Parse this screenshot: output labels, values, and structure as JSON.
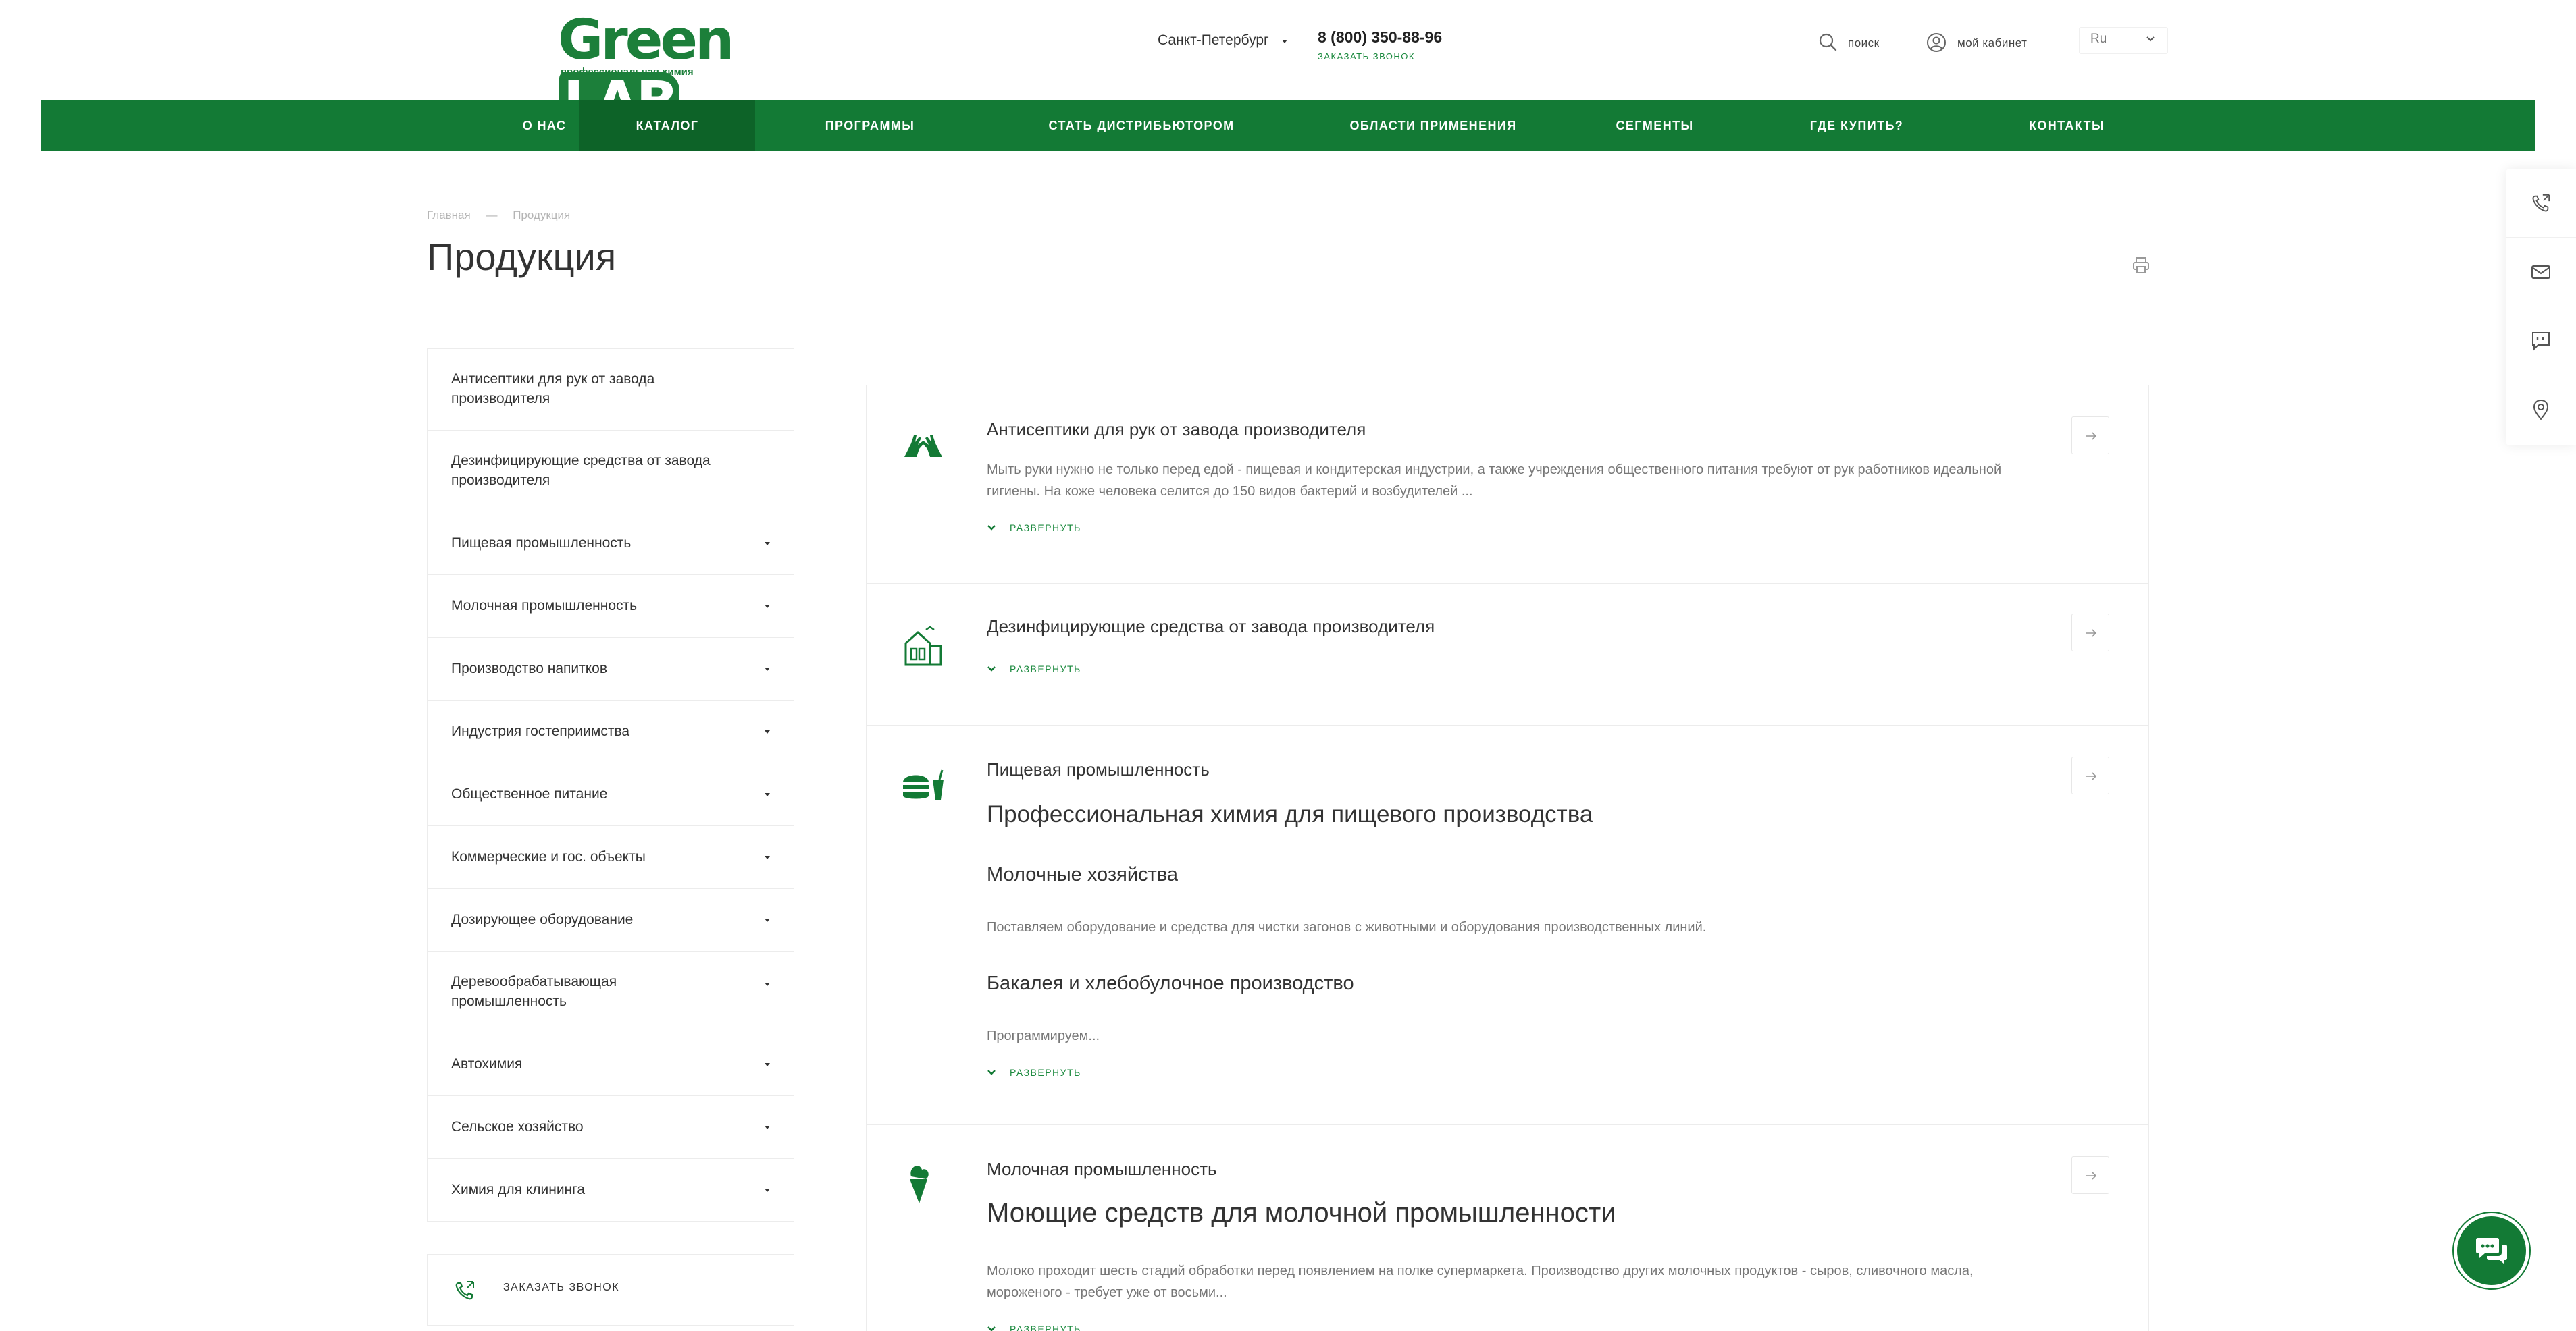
{
  "brand": {
    "logo_main": "Green",
    "logo_accent": "LAB",
    "logo_tagline": "профессиональная химия",
    "color_primary": "#137a35",
    "color_nav_active": "#0d6328"
  },
  "header": {
    "city": "Санкт-Петербург",
    "phone": "8 (800) 350-88-96",
    "callback": "ЗАКАЗАТЬ ЗВОНОК",
    "search": "поиск",
    "cabinet": "мой кабинет",
    "language": "Ru"
  },
  "nav": {
    "items": [
      {
        "label": "О НАС"
      },
      {
        "label": "КАТАЛОГ"
      },
      {
        "label": "ПРОГРАММЫ"
      },
      {
        "label": "СТАТЬ ДИСТРИБЬЮТОРОМ"
      },
      {
        "label": "ОБЛАСТИ ПРИМЕНЕНИЯ"
      },
      {
        "label": "СЕГМЕНТЫ"
      },
      {
        "label": "ГДЕ КУПИТЬ?"
      },
      {
        "label": "КОНТАКТЫ"
      }
    ],
    "active_index": 1
  },
  "breadcrumb": {
    "home": "Главная",
    "separator": "—",
    "current": "Продукция"
  },
  "page": {
    "title": "Продукция"
  },
  "sidebar": {
    "items": [
      {
        "label": "Антисептики для рук от завода производителя",
        "has_children": false
      },
      {
        "label": "Дезинфицирующие средства от завода производителя",
        "has_children": false
      },
      {
        "label": "Пищевая промышленность",
        "has_children": true
      },
      {
        "label": "Молочная промышленность",
        "has_children": true
      },
      {
        "label": "Производство напитков",
        "has_children": true
      },
      {
        "label": "Индустрия гостеприимства",
        "has_children": true
      },
      {
        "label": "Общественное питание",
        "has_children": true
      },
      {
        "label": "Коммерческие и гос. объекты",
        "has_children": true
      },
      {
        "label": "Дозирующее оборудование",
        "has_children": true
      },
      {
        "label": "Деревообрабатывающая промышленность",
        "has_children": true
      },
      {
        "label": "Автохимия",
        "has_children": true
      },
      {
        "label": "Сельское хозяйство",
        "has_children": true
      },
      {
        "label": "Химия для клининга",
        "has_children": true
      }
    ],
    "callback": "ЗАКАЗАТЬ ЗВОНОК"
  },
  "catalog": {
    "expand_label": "РАЗВЕРНУТЬ",
    "sections": [
      {
        "title": "Антисептики для рук от завода производителя",
        "description": "Мыть руки нужно не только перед едой - пищевая и кондитерская индустрии, а также учреждения общественного питания требуют от рук работников идеальной гигиены. На коже человека селится до 150 видов бактерий и возбудителей ...",
        "icon": "gloves-icon"
      },
      {
        "title": "Дезинфицирующие средства от завода производителя",
        "icon": "building-icon"
      },
      {
        "title": "Пищевая промышленность",
        "icon": "burger-drink-icon",
        "heading": "Профессиональная химия для пищевого производства",
        "subsections": [
          {
            "title": "Молочные хозяйства",
            "text": "Поставляем оборудование и средства для чистки загонов с животными и оборудования производственных линий."
          },
          {
            "title": "Бакалея и хлебобулочное производство",
            "text": "Программируем..."
          }
        ]
      },
      {
        "title": "Молочная промышленность",
        "icon": "ice-cream-icon",
        "heading": "Моющие средств для молочной промышленности",
        "description": "Молоко проходит шесть стадий обработки перед появлением на полке супермаркета. Производство других молочных продуктов - сыров, сливочного масла, мороженого - требует уже от восьми..."
      }
    ]
  },
  "floating_panel": {
    "buttons": [
      "phone-callback-icon",
      "mail-icon",
      "chat-bubble-icon",
      "map-pin-icon"
    ]
  },
  "chat_widget": {
    "icon": "chat-icon"
  }
}
